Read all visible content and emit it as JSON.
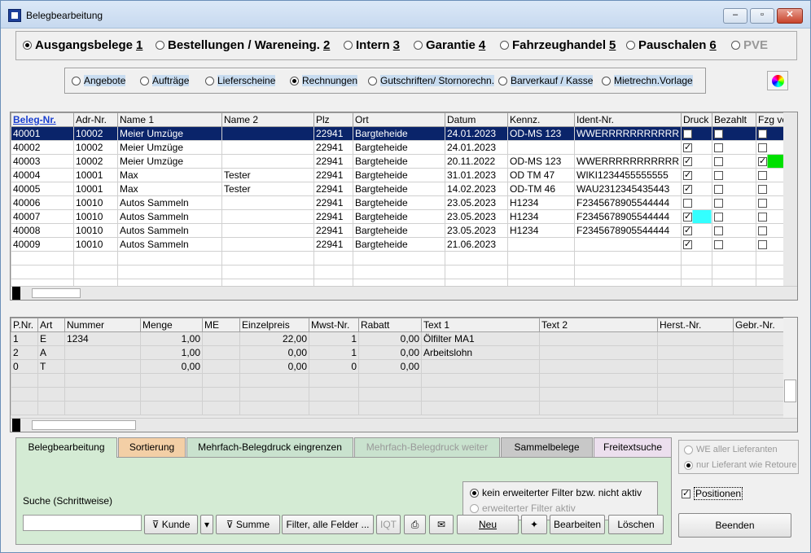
{
  "window": {
    "title": "Belegbearbeitung",
    "minimize": "–",
    "restore": "▫",
    "close": "✕"
  },
  "doc_types": [
    {
      "label": "Ausgangsbelege",
      "key": "1",
      "selected": true,
      "enabled": true
    },
    {
      "label": "Bestellungen / Wareneing.",
      "key": "2",
      "selected": false,
      "enabled": true
    },
    {
      "label": "Intern",
      "key": "3",
      "selected": false,
      "enabled": true
    },
    {
      "label": "Garantie",
      "key": "4",
      "selected": false,
      "enabled": true
    },
    {
      "label": "Fahrzeughandel",
      "key": "5",
      "selected": false,
      "enabled": true
    },
    {
      "label": "Pauschalen",
      "key": "6",
      "selected": false,
      "enabled": true
    },
    {
      "label": "PVE",
      "key": "",
      "selected": false,
      "enabled": false
    }
  ],
  "sub_types": [
    {
      "label": "Angebote",
      "selected": false
    },
    {
      "label": "Aufträge",
      "selected": false
    },
    {
      "label": "Lieferscheine",
      "selected": false
    },
    {
      "label": "Rechnungen",
      "selected": true
    },
    {
      "label": "Gutschriften/ Stornorechn.",
      "selected": false
    },
    {
      "label": "Barverkauf / Kasse",
      "selected": false
    },
    {
      "label": "Mietrechn.Vorlage",
      "selected": false
    }
  ],
  "documents": {
    "columns": [
      "Beleg-Nr.",
      "Adr-Nr.",
      "Name 1",
      "Name 2",
      "Plz",
      "Ort",
      "Datum",
      "Kennz.",
      "Ident-Nr.",
      "Druck",
      "Bezahlt",
      "Fzg vo"
    ],
    "rows": [
      {
        "beleg": "40001",
        "adr": "10002",
        "name1": "Meier Umzüge",
        "name2": "",
        "plz": "22941",
        "ort": "Bargteheide",
        "datum": "24.01.2023",
        "kennz": "OD-MS 123",
        "ident": "WWERRRRRRRRRRR",
        "druck": false,
        "bezahlt": false,
        "fzg": false,
        "fzgcolor": "",
        "druckcolor": "",
        "selected": true
      },
      {
        "beleg": "40002",
        "adr": "10002",
        "name1": "Meier Umzüge",
        "name2": "",
        "plz": "22941",
        "ort": "Bargteheide",
        "datum": "24.01.2023",
        "kennz": "",
        "ident": "",
        "druck": true,
        "bezahlt": false,
        "fzg": false,
        "fzgcolor": "",
        "druckcolor": "",
        "selected": false
      },
      {
        "beleg": "40003",
        "adr": "10002",
        "name1": "Meier Umzüge",
        "name2": "",
        "plz": "22941",
        "ort": "Bargteheide",
        "datum": "20.11.2022",
        "kennz": "OD-MS 123",
        "ident": "WWERRRRRRRRRRR",
        "druck": true,
        "bezahlt": false,
        "fzg": true,
        "fzgcolor": "#00e000",
        "druckcolor": "",
        "selected": false
      },
      {
        "beleg": "40004",
        "adr": "10001",
        "name1": "Max",
        "name2": "Tester",
        "plz": "22941",
        "ort": "Bargteheide",
        "datum": "31.01.2023",
        "kennz": "OD TM 47",
        "ident": "WIKI1234455555555",
        "druck": true,
        "bezahlt": false,
        "fzg": false,
        "fzgcolor": "",
        "druckcolor": "",
        "selected": false
      },
      {
        "beleg": "40005",
        "adr": "10001",
        "name1": "Max",
        "name2": "Tester",
        "plz": "22941",
        "ort": "Bargteheide",
        "datum": "14.02.2023",
        "kennz": "OD-TM 46",
        "ident": "WAU2312345435443",
        "druck": true,
        "bezahlt": false,
        "fzg": false,
        "fzgcolor": "",
        "druckcolor": "",
        "selected": false
      },
      {
        "beleg": "40006",
        "adr": "10010",
        "name1": "Autos Sammeln",
        "name2": "",
        "plz": "22941",
        "ort": "Bargteheide",
        "datum": "23.05.2023",
        "kennz": "H1234",
        "ident": "F2345678905544444",
        "druck": false,
        "bezahlt": false,
        "fzg": false,
        "fzgcolor": "",
        "druckcolor": "",
        "selected": false
      },
      {
        "beleg": "40007",
        "adr": "10010",
        "name1": "Autos Sammeln",
        "name2": "",
        "plz": "22941",
        "ort": "Bargteheide",
        "datum": "23.05.2023",
        "kennz": "H1234",
        "ident": "F2345678905544444",
        "druck": true,
        "bezahlt": false,
        "fzg": false,
        "fzgcolor": "",
        "druckcolor": "#33ffff",
        "selected": false
      },
      {
        "beleg": "40008",
        "adr": "10010",
        "name1": "Autos Sammeln",
        "name2": "",
        "plz": "22941",
        "ort": "Bargteheide",
        "datum": "23.05.2023",
        "kennz": "H1234",
        "ident": "F2345678905544444",
        "druck": true,
        "bezahlt": false,
        "fzg": false,
        "fzgcolor": "",
        "druckcolor": "",
        "selected": false
      },
      {
        "beleg": "40009",
        "adr": "10010",
        "name1": "Autos Sammeln",
        "name2": "",
        "plz": "22941",
        "ort": "Bargteheide",
        "datum": "21.06.2023",
        "kennz": "",
        "ident": "",
        "druck": true,
        "bezahlt": false,
        "fzg": false,
        "fzgcolor": "",
        "druckcolor": "",
        "selected": false
      }
    ]
  },
  "positions": {
    "columns": [
      "P.Nr.",
      "Art",
      "Nummer",
      "Menge",
      "ME",
      "Einzelpreis",
      "Mwst-Nr.",
      "Rabatt",
      "Text 1",
      "Text 2",
      "Herst.-Nr.",
      "Gebr.-Nr."
    ],
    "rows": [
      {
        "pnr": "1",
        "art": "E",
        "nummer": "1234",
        "menge": "1,00",
        "me": "",
        "preis": "22,00",
        "mwst": "1",
        "rabatt": "0,00",
        "text1": "Ölfilter MA1",
        "text2": "",
        "herst": "",
        "gebr": ""
      },
      {
        "pnr": "2",
        "art": "A",
        "nummer": "",
        "menge": "1,00",
        "me": "",
        "preis": "0,00",
        "mwst": "1",
        "rabatt": "0,00",
        "text1": "Arbeitslohn",
        "text2": "",
        "herst": "",
        "gebr": ""
      },
      {
        "pnr": "0",
        "art": "T",
        "nummer": "",
        "menge": "0,00",
        "me": "",
        "preis": "0,00",
        "mwst": "0",
        "rabatt": "0,00",
        "text1": "",
        "text2": "",
        "herst": "",
        "gebr": ""
      }
    ]
  },
  "tabs": [
    {
      "label": "Belegbearbeitung",
      "active": true,
      "enabled": true,
      "bg": "#d4ebd4"
    },
    {
      "label": "Sortierung",
      "active": false,
      "enabled": true,
      "bg": "#f3cfa6"
    },
    {
      "label": "Mehrfach-Belegdruck eingrenzen",
      "active": false,
      "enabled": true,
      "bg": "#c9e2ce"
    },
    {
      "label": "Mehrfach-Belegdruck weiter",
      "active": false,
      "enabled": false,
      "bg": "#c9e2ce"
    },
    {
      "label": "Sammelbelege",
      "active": false,
      "enabled": true,
      "bg": "#c8c8c8"
    },
    {
      "label": "Freitextsuche",
      "active": false,
      "enabled": true,
      "bg": "#ecdfee"
    }
  ],
  "search": {
    "label": "Suche (Schrittweise)",
    "value": ""
  },
  "filter": {
    "option1": "kein erweiterter Filter bzw. nicht aktiv",
    "option2": "erweiterter Filter aktiv"
  },
  "buttons": {
    "kunde": "Kunde",
    "summe": "Summe",
    "filter_all": "Filter, alle Felder ...",
    "iqt": "IQT",
    "neu": "Neu",
    "bearbeiten": "Bearbeiten",
    "loeschen": "Löschen",
    "beenden": "Beenden"
  },
  "right_panel": {
    "we_all": "WE aller Lieferanten",
    "nur_lieferant": "nur Lieferant wie Retoure",
    "positionen": "Positionen",
    "positionen_checked": true
  }
}
